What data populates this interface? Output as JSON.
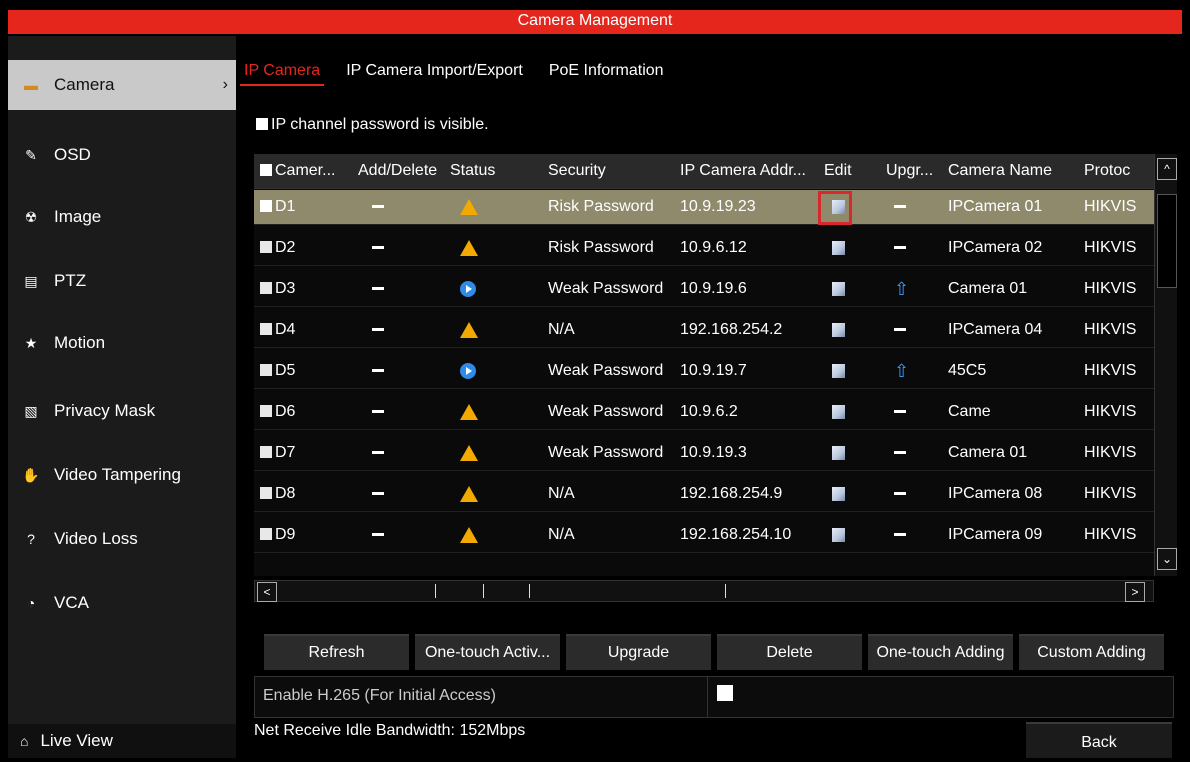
{
  "window": {
    "title": "Camera Management"
  },
  "sidebar": {
    "items": [
      {
        "label": "Camera",
        "icon": "camera-icon",
        "glyph": "▬",
        "active": true
      },
      {
        "label": "OSD",
        "icon": "osd-icon",
        "glyph": "✎",
        "active": false
      },
      {
        "label": "Image",
        "icon": "image-icon",
        "glyph": "☢",
        "active": false
      },
      {
        "label": "PTZ",
        "icon": "ptz-icon",
        "glyph": "▤",
        "active": false
      },
      {
        "label": "Motion",
        "icon": "motion-icon",
        "glyph": "★",
        "active": false
      },
      {
        "label": "Privacy Mask",
        "icon": "privacy-mask-icon",
        "glyph": "▧",
        "active": false
      },
      {
        "label": "Video Tampering",
        "icon": "video-tampering-icon",
        "glyph": "✋",
        "active": false
      },
      {
        "label": "Video Loss",
        "icon": "video-loss-icon",
        "glyph": "?",
        "active": false
      },
      {
        "label": "VCA",
        "icon": "vca-icon",
        "glyph": "◔",
        "active": false
      }
    ],
    "live_view": {
      "label": "Live View",
      "icon": "home-icon",
      "glyph": "⌂"
    }
  },
  "tabs": [
    {
      "label": "IP Camera",
      "active": true
    },
    {
      "label": "IP Camera Import/Export",
      "active": false
    },
    {
      "label": "PoE Information",
      "active": false
    }
  ],
  "password_visible": {
    "label": "IP channel password is visible."
  },
  "table": {
    "columns": [
      "Camer...",
      "Add/Delete",
      "Status",
      "Security",
      "IP Camera Addr...",
      "Edit",
      "Upgr...",
      "Camera Name",
      "Protoc"
    ],
    "rows": [
      {
        "id": "D1",
        "status": "warning",
        "security": "Risk Password",
        "ip": "10.9.19.23",
        "upgrade": false,
        "name": "IPCamera 01",
        "protocol": "HIKVIS",
        "selected": true
      },
      {
        "id": "D2",
        "status": "warning",
        "security": "Risk Password",
        "ip": "10.9.6.12",
        "upgrade": false,
        "name": "IPCamera 02",
        "protocol": "HIKVIS",
        "selected": false
      },
      {
        "id": "D3",
        "status": "playing",
        "security": "Weak Password",
        "ip": "10.9.19.6",
        "upgrade": true,
        "name": "Camera 01",
        "protocol": "HIKVIS",
        "selected": false
      },
      {
        "id": "D4",
        "status": "warning",
        "security": "N/A",
        "ip": "192.168.254.2",
        "upgrade": false,
        "name": "IPCamera 04",
        "protocol": "HIKVIS",
        "selected": false
      },
      {
        "id": "D5",
        "status": "playing",
        "security": "Weak Password",
        "ip": "10.9.19.7",
        "upgrade": true,
        "name": "45C5",
        "protocol": "HIKVIS",
        "selected": false
      },
      {
        "id": "D6",
        "status": "warning",
        "security": "Weak Password",
        "ip": "10.9.6.2",
        "upgrade": false,
        "name": "Came",
        "protocol": "HIKVIS",
        "selected": false
      },
      {
        "id": "D7",
        "status": "warning",
        "security": "Weak Password",
        "ip": "10.9.19.3",
        "upgrade": false,
        "name": "Camera 01",
        "protocol": "HIKVIS",
        "selected": false
      },
      {
        "id": "D8",
        "status": "warning",
        "security": "N/A",
        "ip": "192.168.254.9",
        "upgrade": false,
        "name": "IPCamera 08",
        "protocol": "HIKVIS",
        "selected": false
      },
      {
        "id": "D9",
        "status": "warning",
        "security": "N/A",
        "ip": "192.168.254.10",
        "upgrade": false,
        "name": "IPCamera 09",
        "protocol": "HIKVIS",
        "selected": false
      }
    ]
  },
  "actions": [
    "Refresh",
    "One-touch Activ...",
    "Upgrade",
    "Delete",
    "One-touch Adding",
    "Custom Adding"
  ],
  "h265": {
    "label": "Enable H.265 (For Initial Access)"
  },
  "bandwidth": "Net Receive Idle Bandwidth: 152Mbps",
  "back_label": "Back",
  "colors": {
    "accent": "#e4261d",
    "selected_row": "#8f8a6b",
    "warning": "#f2a900",
    "info": "#2f8be8"
  }
}
